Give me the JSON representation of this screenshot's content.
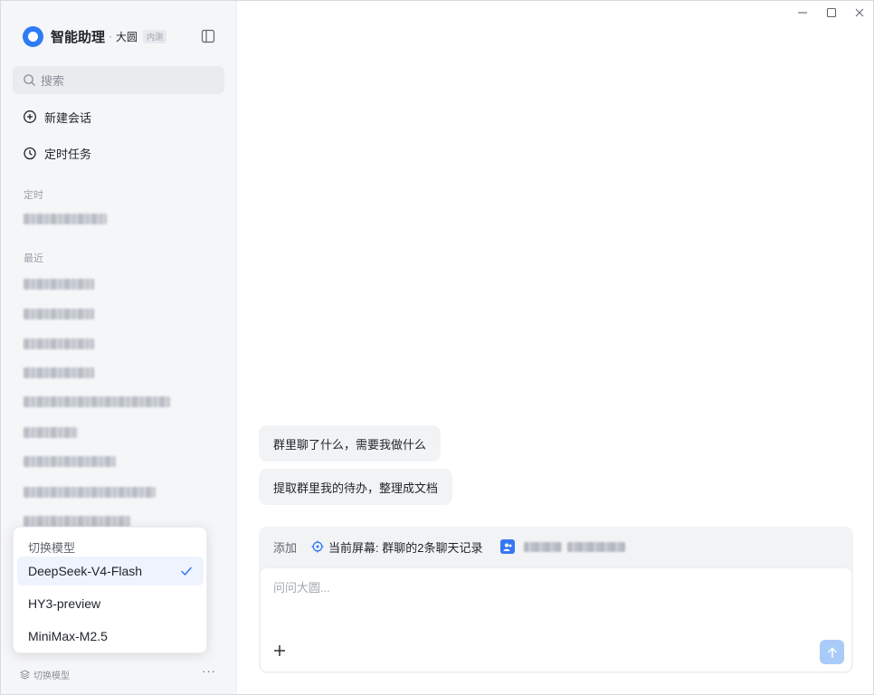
{
  "brand": {
    "name": "智能助理",
    "dot": "·",
    "sub": "大圆",
    "badge": "内测"
  },
  "search": {
    "placeholder": "搜索"
  },
  "nav": {
    "new_chat": "新建会话",
    "scheduled": "定时任务"
  },
  "sections": {
    "scheduled": "定时",
    "recent": "最近"
  },
  "model_popup": {
    "title": "切换模型",
    "options": [
      {
        "label": "DeepSeek-V4-Flash",
        "selected": true
      },
      {
        "label": "HY3-preview",
        "selected": false
      },
      {
        "label": "MiniMax-M2.5",
        "selected": false
      }
    ]
  },
  "footer": {
    "switch_model": "切换模型",
    "more": "···"
  },
  "chat": {
    "suggestions": [
      "群里聊了什么，需要我做什么",
      "提取群里我的待办，整理成文档"
    ]
  },
  "composer": {
    "add_label": "添加",
    "screen_context": "当前屏幕: 群聊的2条聊天记录",
    "placeholder": "问问大圆..."
  },
  "colors": {
    "accent": "#2f7bf5",
    "send_disabled": "#a9cbf8",
    "sidebar_bg": "#f5f6f8"
  }
}
